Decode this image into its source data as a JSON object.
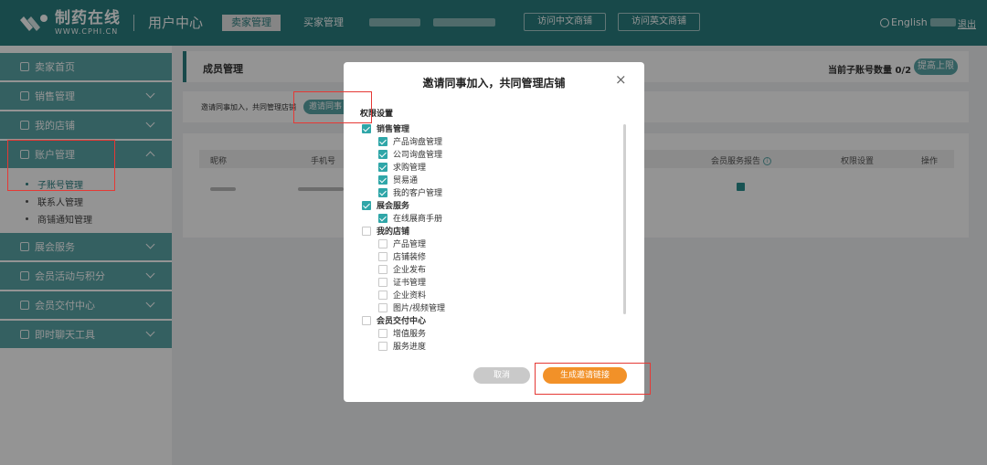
{
  "header": {
    "logo_cn": "制药在线",
    "logo_en": "WWW.CPHI.CN",
    "user_center": "用户中心",
    "tabs": [
      {
        "label": "卖家管理",
        "active": true
      },
      {
        "label": "买家管理",
        "active": false
      }
    ],
    "buttons": [
      "访问中文商铺",
      "访问英文商铺"
    ],
    "language": "English",
    "logout": "退出"
  },
  "sidebar": {
    "items": [
      {
        "label": "卖家首页"
      },
      {
        "label": "销售管理"
      },
      {
        "label": "我的店铺"
      },
      {
        "label": "账户管理",
        "expanded": true
      },
      {
        "label": "展会服务"
      },
      {
        "label": "会员活动与积分"
      },
      {
        "label": "会员交付中心"
      },
      {
        "label": "即时聊天工具"
      }
    ],
    "sub_items": [
      {
        "label": "子账号管理",
        "active": true
      },
      {
        "label": "联系人管理"
      },
      {
        "label": "商铺通知管理"
      }
    ]
  },
  "main": {
    "title": "成员管理",
    "quota_text": "当前子账号数量 0/2",
    "raise_button": "提高上限",
    "invite_text": "邀请同事加入，共同管理店铺",
    "invite_button": "邀请同事",
    "table": {
      "headers": [
        "昵称",
        "手机号",
        "会员服务报告",
        "权限设置",
        "操作"
      ]
    }
  },
  "modal": {
    "title": "邀请同事加入，共同管理店铺",
    "close": "×",
    "section_label": "权限设置",
    "permissions": [
      {
        "label": "销售管理",
        "checked": true,
        "group": true
      },
      {
        "label": "产品询盘管理",
        "checked": true,
        "group": false
      },
      {
        "label": "公司询盘管理",
        "checked": true,
        "group": false
      },
      {
        "label": "求购管理",
        "checked": true,
        "group": false
      },
      {
        "label": "贸易通",
        "checked": true,
        "group": false
      },
      {
        "label": "我的客户管理",
        "checked": true,
        "group": false
      },
      {
        "label": "展会服务",
        "checked": true,
        "group": true
      },
      {
        "label": "在线展商手册",
        "checked": true,
        "group": false
      },
      {
        "label": "我的店铺",
        "checked": false,
        "group": true
      },
      {
        "label": "产品管理",
        "checked": false,
        "group": false
      },
      {
        "label": "店铺装修",
        "checked": false,
        "group": false
      },
      {
        "label": "企业发布",
        "checked": false,
        "group": false
      },
      {
        "label": "证书管理",
        "checked": false,
        "group": false
      },
      {
        "label": "企业资料",
        "checked": false,
        "group": false
      },
      {
        "label": "图片/视频管理",
        "checked": false,
        "group": false
      },
      {
        "label": "会员交付中心",
        "checked": false,
        "group": true
      },
      {
        "label": "增值服务",
        "checked": false,
        "group": false
      },
      {
        "label": "服务进度",
        "checked": false,
        "group": false
      }
    ],
    "cancel_button": "取消",
    "generate_button": "生成邀请链接"
  },
  "colors": {
    "brand": "#2a7f80",
    "sidebar": "#5aa6a8",
    "accent_orange": "#f29128",
    "highlight_red": "#e53935"
  }
}
